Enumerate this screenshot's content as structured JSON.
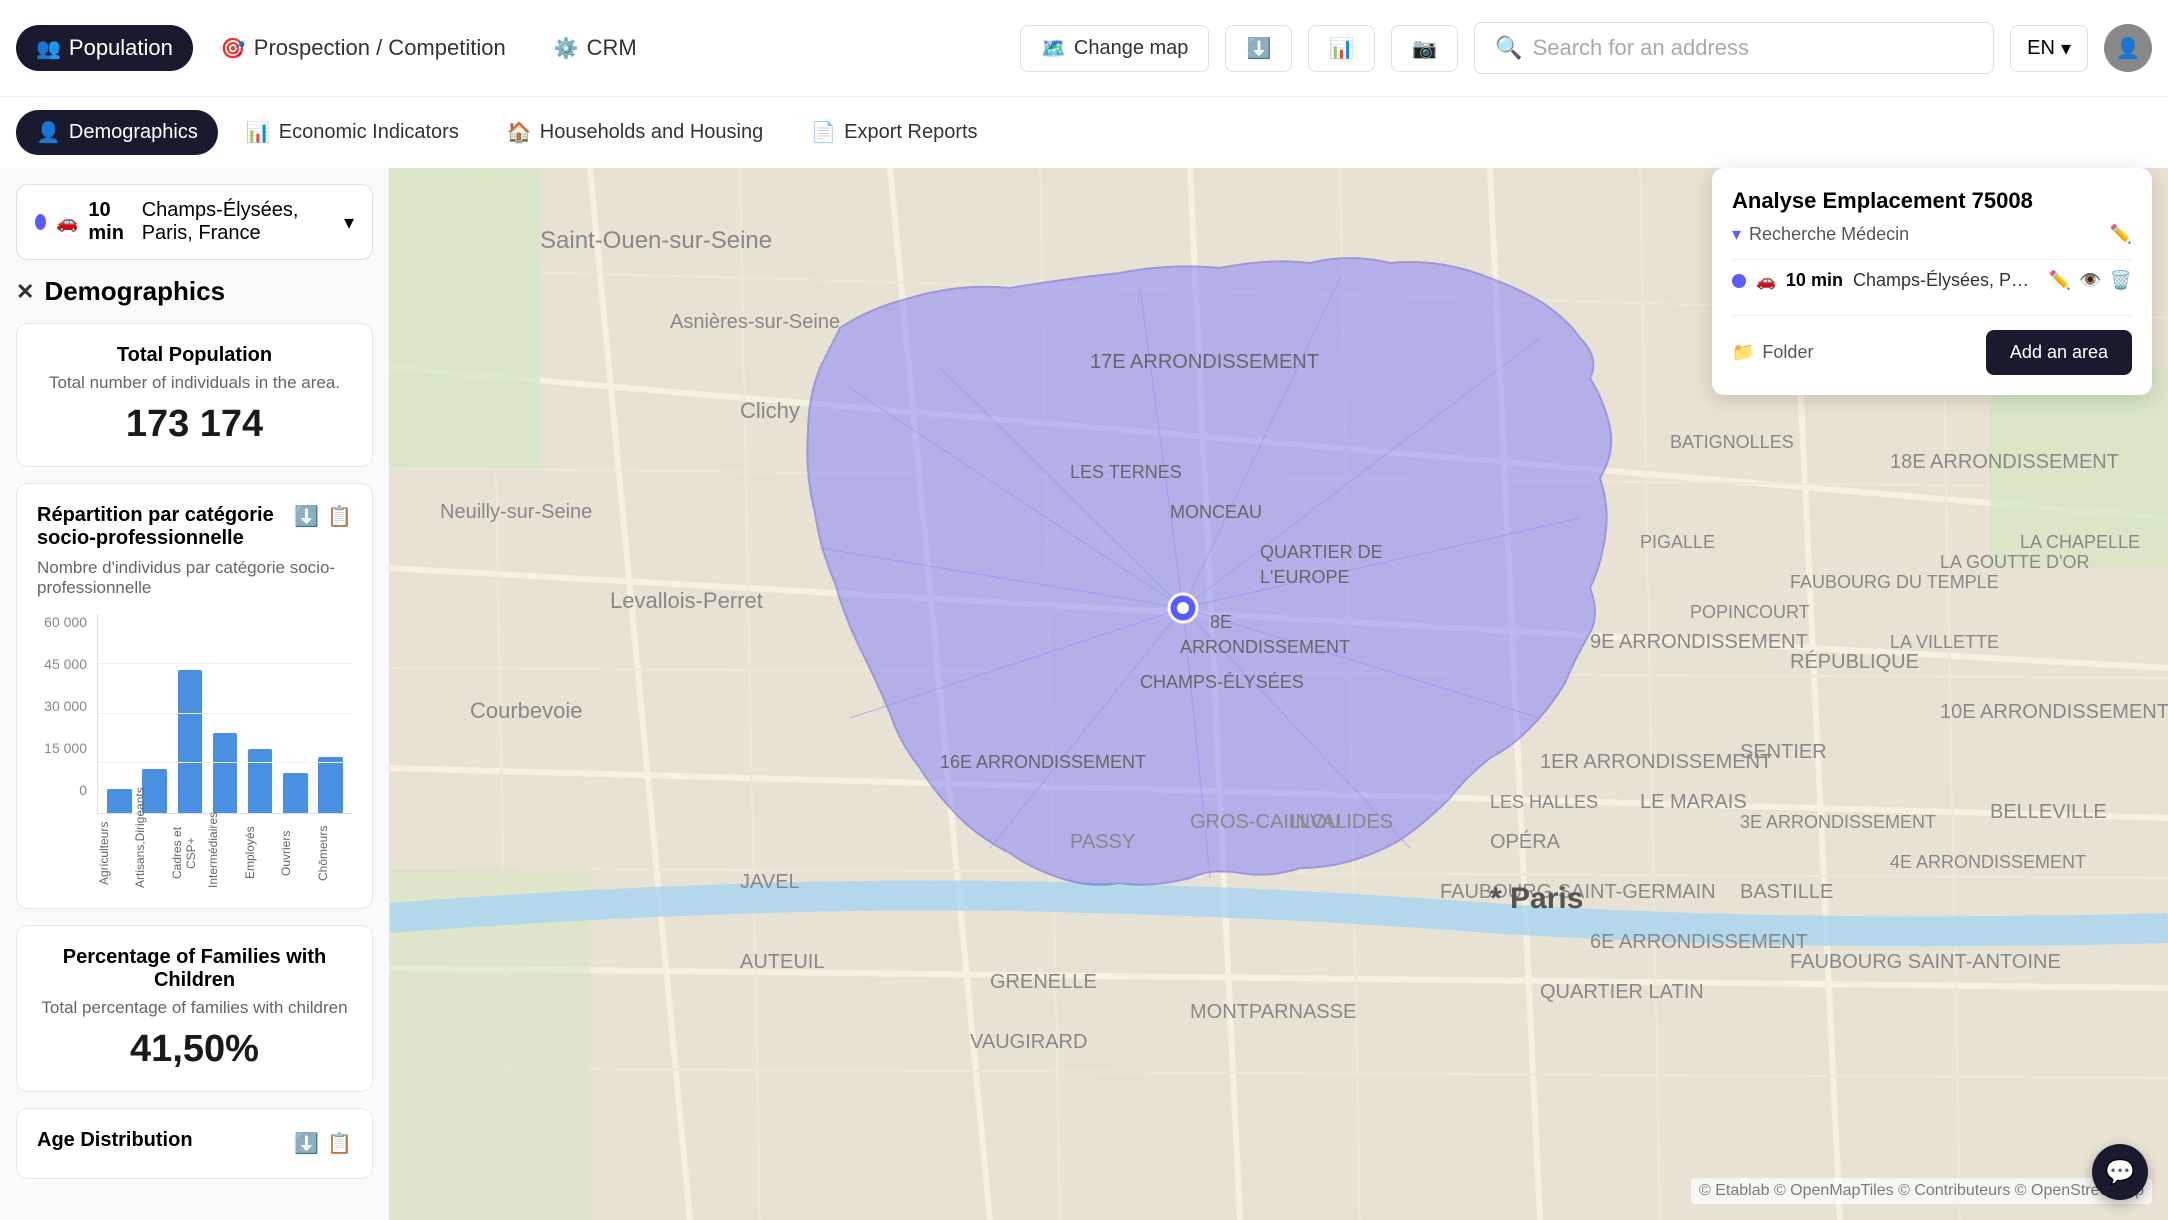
{
  "nav": {
    "tabs": [
      {
        "id": "population",
        "label": "Population",
        "icon": "👥",
        "active_dark": true
      },
      {
        "id": "prospection",
        "label": "Prospection / Competition",
        "icon": "🎯",
        "active_dark": false
      },
      {
        "id": "crm",
        "label": "CRM",
        "icon": "⚙️",
        "active_dark": false
      }
    ],
    "right": {
      "change_map": "Change map",
      "language": "EN",
      "search_placeholder": "Search for an address"
    }
  },
  "second_nav": {
    "tabs": [
      {
        "id": "demographics",
        "label": "Demographics",
        "icon": "👤",
        "active": true
      },
      {
        "id": "economic",
        "label": "Economic Indicators",
        "icon": "📊",
        "active": false
      },
      {
        "id": "households",
        "label": "Households and Housing",
        "icon": "🏠",
        "active": false
      },
      {
        "id": "export",
        "label": "Export Reports",
        "icon": "📄",
        "active": false
      }
    ]
  },
  "location_selector": {
    "minutes": "10 min",
    "address": "Champs-Élysées, Paris, France"
  },
  "panel_title": "Demographics",
  "cards": {
    "total_population": {
      "title": "Total Population",
      "subtitle": "Total number of individuals in the area.",
      "value": "173 174"
    },
    "families": {
      "title": "Percentage of Families with Children",
      "subtitle": "Total percentage of families with children",
      "value": "41,50%"
    },
    "age_distribution": {
      "title": "Age Distribution"
    }
  },
  "chart": {
    "title": "Répartition par catégorie socio-professionnelle",
    "subtitle": "Nombre d'individus par catégorie socio-professionnelle",
    "y_labels": [
      "60 000",
      "45 000",
      "30 000",
      "15 000",
      "0"
    ],
    "bars": [
      {
        "label": "Agriculteurs",
        "height_pct": 12
      },
      {
        "label": "Artisans,Dirigeants",
        "height_pct": 22
      },
      {
        "label": "Cadres et CSP+",
        "height_pct": 72
      },
      {
        "label": "Intermédiaires",
        "height_pct": 40
      },
      {
        "label": "Employés",
        "height_pct": 32
      },
      {
        "label": "Ouvriers",
        "height_pct": 20
      },
      {
        "label": "Chômeurs",
        "height_pct": 28
      }
    ]
  },
  "right_panel": {
    "title": "Analyse Emplacement 75008",
    "subtitle": "Recherche Médecin",
    "area": {
      "minutes": "10 min",
      "address": "Champs-Élysées, P…"
    },
    "folder_label": "Folder",
    "add_area_label": "Add an area"
  },
  "map_watermark": "© Etablab © OpenMapTiles © Contributeurs © OpenStreetMap",
  "chat_icon": "💬"
}
